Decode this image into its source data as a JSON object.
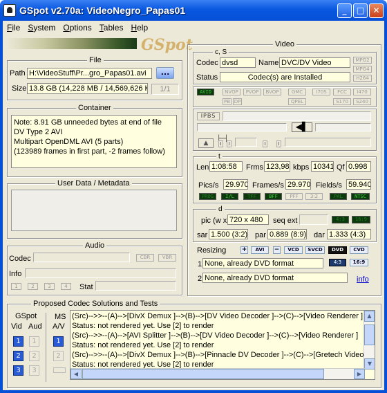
{
  "window": {
    "title": "GSpot v2.70a: VideoNegro_Papas01"
  },
  "menu": [
    "File",
    "System",
    "Options",
    "Tables",
    "Help"
  ],
  "logo": "GSpot",
  "file": {
    "legend": "File",
    "path_label": "Path",
    "path_value": "H:\\VideoStuff\\Pr...gro_Papas01.avi",
    "browse": "...",
    "size_label": "Size",
    "size_value": "13.8 GB (14,228 MB / 14,569,626 K",
    "part": "1/1"
  },
  "container": {
    "legend": "Container",
    "lines": [
      "Note: 8.91 GB unneeded bytes at end of file",
      "DV Type 2 AVI",
      "Multipart OpenDML AVI (5 parts)",
      "(123989 frames in first part, -2 frames follow)"
    ]
  },
  "userdata": {
    "legend": "User Data / Metadata"
  },
  "audio": {
    "legend": "Audio",
    "codec_label": "Codec",
    "cbr": "CBR",
    "vbr": "VBR",
    "info_label": "Info",
    "stat_label": "Stat",
    "buttons": [
      "1",
      "2",
      "3",
      "4"
    ]
  },
  "video": {
    "legend": "Video",
    "cs_legend": "c, S",
    "codec_label": "Codec",
    "codec_value": "dvsd",
    "name_label": "Name",
    "name_value": "DVC/DV Video",
    "mpg2": "MPG2",
    "mpg4": "MPG4",
    "h264": "H264",
    "status_label": "Status",
    "status_value": "Codec(s) are Installed",
    "flags1": [
      "AVID",
      "NVOP",
      "PVOP",
      "BVOP",
      "GMC",
      "I70S",
      "FCC",
      "I470"
    ],
    "flags2": [
      "PB",
      "DP",
      "QPEL",
      "S170",
      "S240"
    ],
    "ipbs": "IPBS",
    "t_legend": "t",
    "len_label": "Len",
    "len_value": "1:08:58",
    "frms_label": "Frms",
    "frms_value": "123,987",
    "kbps_label": "kbps",
    "kbps_value": "10341",
    "qf_label": "Qf",
    "qf_value": "0.998",
    "pics_label": "Pics/s",
    "pics_value": "29.970",
    "frames_label": "Frames/s",
    "frames_value": "29.970",
    "fields_label": "Fields/s",
    "fields_value": "59.940",
    "flags3": [
      "PROG",
      "I/L",
      "TFF",
      "BFF",
      "PFF",
      "3:2",
      "PAL",
      "NTSC"
    ],
    "d_legend": "d",
    "pic_label": "pic (w x h)",
    "pic_value": "720 x 480",
    "seq_label": "seq ext",
    "r43": "4:3",
    "r169": "16:9",
    "sar_label": "sar",
    "sar_value": "1.500 (3:2)",
    "par_label": "par",
    "par_value": "0.889 (8:9)",
    "dar_label": "dar",
    "dar_value": "1.333 (4:3)",
    "resizing_label": "Resizing",
    "avi": "AVI",
    "vcd": "VCD",
    "svcd": "SVCD",
    "dvd": "DVD",
    "cvd": "CVD",
    "resize1_num": "1",
    "resize1": "None, already DVD format",
    "resize2_num": "2",
    "resize2": "None, already DVD format",
    "info_link": "info"
  },
  "proposed": {
    "legend": "Proposed Codec Solutions and Tests",
    "gspot": "GSpot",
    "vid": "Vid",
    "aud": "Aud",
    "ms": "MS",
    "av": "A/V",
    "lines": [
      "(Src)-->>--(A)-->[DivX Demux ]-->(B)-->[DV Video Decoder ]-->(C)-->[Video Renderer ]",
      "Status: not rendered yet. Use [2] to render",
      "(Src)-->>--(A)-->[AVI Splitter ]-->(B)-->[DV Video Decoder ]-->(C)-->[Video Renderer ]",
      "Status: not rendered yet. Use [2] to render",
      "(Src)-->>--(A)-->[DivX Demux ]-->(B)-->[Pinnacle DV Decoder ]-->(C)-->[Gretech Video Filter",
      "Status: not rendered yet. Use [2] to render"
    ]
  },
  "colors": {
    "titlebar": "#0a58e0",
    "panel": "#ece9d8",
    "yellow_field": "#ffffe0",
    "green_flag": "#3ecb3e"
  }
}
